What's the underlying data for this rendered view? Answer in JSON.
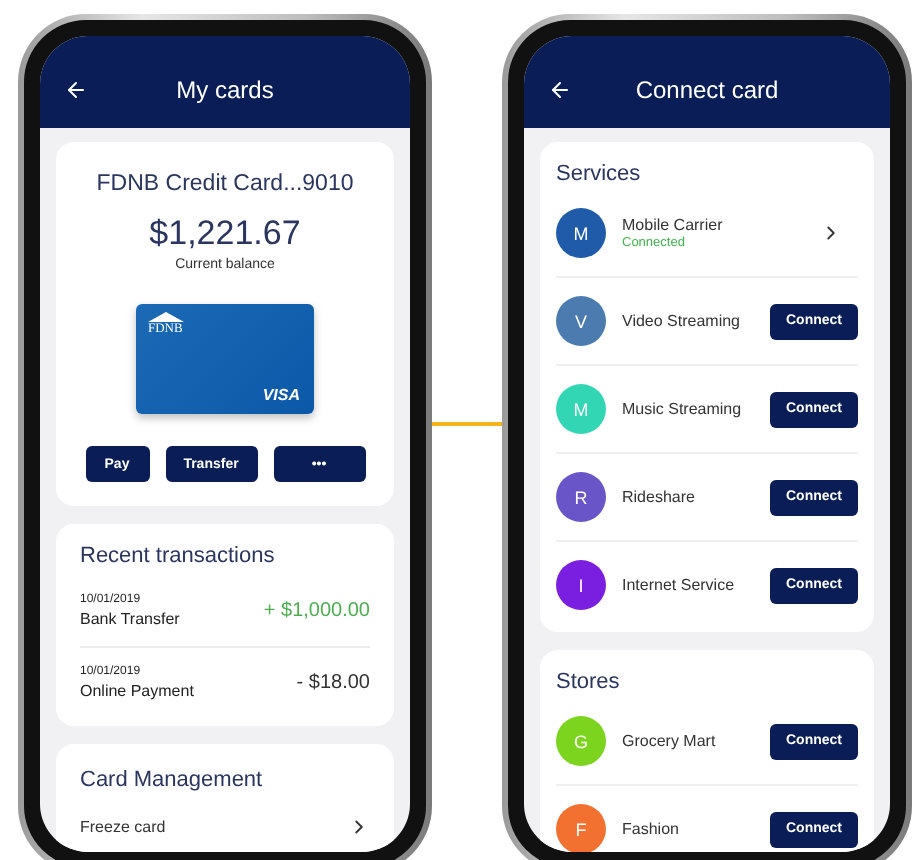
{
  "my_cards_screen": {
    "title": "My cards",
    "account": {
      "name": "FDNB Credit Card...9010",
      "balance": "$1,221.67",
      "balance_label": "Current balance",
      "card": {
        "bank_mark": "FDNB",
        "network": "VISA"
      },
      "actions": [
        "Pay",
        "Transfer",
        "•••"
      ]
    },
    "recent_transactions": {
      "heading": "Recent transactions",
      "items": [
        {
          "date": "10/01/2019",
          "description": "Bank Transfer",
          "amount": "+ $1,000.00",
          "kind": "credit"
        },
        {
          "date": "10/01/2019",
          "description": "Online Payment",
          "amount": "- $18.00",
          "kind": "debit"
        }
      ]
    },
    "card_management": {
      "heading": "Card Management",
      "items": [
        "Freeze card"
      ]
    }
  },
  "connect_card_screen": {
    "title": "Connect card",
    "sections": [
      {
        "heading": "Services",
        "items": [
          {
            "initial": "M",
            "name": "Mobile Carrier",
            "color": "#1f5ba8",
            "kind": "connected",
            "status": "Connected"
          },
          {
            "initial": "V",
            "name": "Video Streaming",
            "color": "#4c7bb0",
            "kind": "connect",
            "action": "Connect"
          },
          {
            "initial": "M",
            "name": "Music Streaming",
            "color": "#33d6b4",
            "kind": "connect",
            "action": "Connect"
          },
          {
            "initial": "R",
            "name": "Rideshare",
            "color": "#6a55c8",
            "kind": "connect",
            "action": "Connect"
          },
          {
            "initial": "I",
            "name": "Internet Service",
            "color": "#7a1fe0",
            "kind": "connect",
            "action": "Connect"
          }
        ]
      },
      {
        "heading": "Stores",
        "items": [
          {
            "initial": "G",
            "name": "Grocery Mart",
            "color": "#7cd41e",
            "kind": "connect",
            "action": "Connect"
          },
          {
            "initial": "F",
            "name": "Fashion",
            "color": "#f27030",
            "kind": "connect",
            "action": "Connect"
          }
        ]
      }
    ]
  }
}
